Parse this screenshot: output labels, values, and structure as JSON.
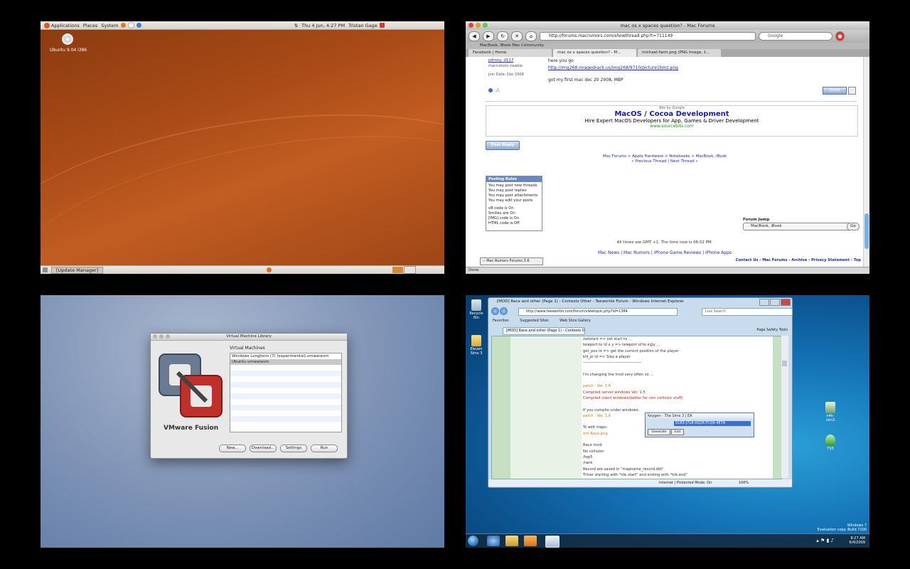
{
  "ubuntu": {
    "panel": {
      "applications": "Applications",
      "places": "Places",
      "system": "System",
      "clock": "Thu 4 Jun,  4:27 PM",
      "user": "Tristan Gage"
    },
    "desktop_icon_label": "Ubuntu 9.04 i386",
    "taskbar_window": "[Update Manager]"
  },
  "mac": {
    "window_title": "mac os x spaces question? - Mac Forums",
    "url": "http://forums.macrumors.com/showthread.php?t=711149",
    "search_placeholder": "Google",
    "bookmarks": "MacBook, iBook    Mac Community",
    "tabs": [
      "Facebook | Home",
      "mac os x spaces question? - M...",
      "michael-farm.png (PNG Image, 1..."
    ],
    "post": {
      "username": "johnny_d117",
      "user_title": "macrumors newbie",
      "join_date": "Join Date: Dec 2008",
      "line1": "here you go",
      "image_link": "http://img268.imageshack.us/img268/9710/picture1bmz.png",
      "line2": "got my first mac dec 20 2008, MBP",
      "quote_label": "Quote"
    },
    "ad": {
      "label": "Ads by Google",
      "title": "MacOS / Cocoa Development",
      "subtitle": "Hire Expert MacOS Developers for App, Games & Driver Development",
      "url": "www.sourcebits.com"
    },
    "post_reply": "Post Reply",
    "breadcrumb": "Mac Forums > Apple Hardware > Notebooks > MacBook, iBook",
    "thread_nav": "« Previous Thread | Next Thread »",
    "posting_rules": {
      "title": "Posting Rules",
      "lines": [
        "You may post new threads",
        "You may post replies",
        "You may post attachments",
        "You may edit your posts"
      ],
      "codes": [
        "vB code is On",
        "Smilies are On",
        "[IMG] code is On",
        "HTML code is Off"
      ]
    },
    "forum_jump_label": "Forum Jump",
    "forum_jump_value": "MacBook, iBook",
    "go_label": "Go",
    "timezone": "All times are GMT +1. The time now is 06:02 PM.",
    "footer_links": "Mac News | Mac Rumors | iPhone Game Reviews | iPhone Apps",
    "style_select": "-- Mac Rumors Forums 3.6",
    "bottom_links": "Contact Us - Mac Forums - Archive - Privacy Statement - Top",
    "status": "Done"
  },
  "vmware": {
    "window_title": "Virtual Machine Library",
    "list_title": "Virtual Machines",
    "machines": [
      "Windows Longhorn (7) (experimental).vmwarevm",
      "Ubuntu.vmwarevm"
    ],
    "brand": "VMware Fusion",
    "buttons": [
      "New...",
      "Download...",
      "Settings",
      "Run"
    ]
  },
  "win7": {
    "ie_title": "[MOD] Race and other (Page 1) - Contests Other - Teeworlds Forum - Windows Internet Explorer",
    "address": "http://www.teeworlds.com/forum/viewtopic.php?id=1384",
    "search_placeholder": "Live Search",
    "favorites": "Favorites",
    "suggested": "Suggested Sites",
    "slice_gallery": "Web Slice Gallery",
    "tab": "[MOD] Race and other (Page 1) - Contests Othe...",
    "toolbar": "Page  Safety  Tools",
    "lines": [
      "    /setstart        => set start to ...",
      "teleport to id x y        => teleport id to x@y ...",
      "get_pos id              => get the current position of the player",
      "kill_pl id                => Slay a player",
      "--------------------------------------------",
      "",
      "I'm changing the mod very often so ...",
      "",
      "patch : Ver. 1.6",
      "Compiled server windows Ver. 1.5",
      "Compiled client windows(better for non collision stuff)",
      "",
      "If you compile under windows:",
      "patch : Ver. 1.6",
      "",
      "To edit maps:",
      "ent-Race.png",
      "",
      "Race mod:",
      "No collision",
      "/top5",
      "/rank",
      "Record are saved in \"mapname_record.dtb\"",
      "Timer starting with \"tile start\" and ending with \"tile end\""
    ],
    "keygen": {
      "title": "Keygen - The Sims 3 | EA",
      "value": "0183-J7L8-XQ2R-TCQ6-4E7A",
      "generate": "Generate",
      "exit": "Exit",
      "credit": "..."
    },
    "status": "Internet | Protected Mode: On",
    "zoom": "100%",
    "recycle_bin": "Recycle Bin",
    "desktop_folder": "Eleven Sims 3",
    "desktop_icon_right1": "n4k-sim3",
    "desktop_icon_right2": "TS3",
    "watermark": [
      "Windows 7",
      "Evaluation copy. Build 7100"
    ],
    "clock": [
      "8:27 AM",
      "6/4/2009"
    ]
  }
}
